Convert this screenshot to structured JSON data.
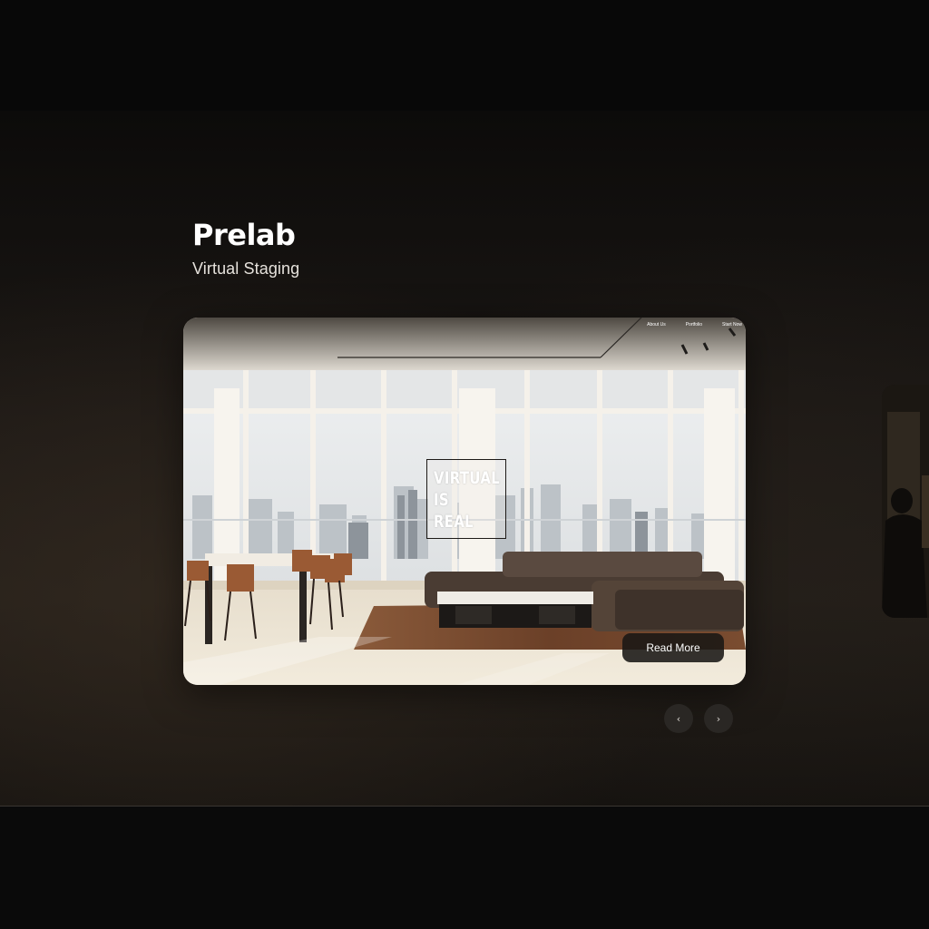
{
  "brand": {
    "title": "Prelab",
    "subtitle": "Virtual Staging"
  },
  "slide": {
    "nav_items": [
      "About Us",
      "Portfolio",
      "Start Now"
    ],
    "badge_lines": [
      "VIRTUAL",
      "IS",
      "REAL"
    ],
    "read_more_label": "Read More"
  },
  "carousel": {
    "prev_icon": "‹",
    "next_icon": "›"
  },
  "icons": {
    "prev": "chevron-left-icon",
    "next": "chevron-right-icon"
  },
  "colors": {
    "background": "#060606",
    "hero_warm": "#221d18",
    "button_dark": "#191715",
    "arrow_bg": "#2a2724",
    "text_primary": "#ffffff"
  }
}
